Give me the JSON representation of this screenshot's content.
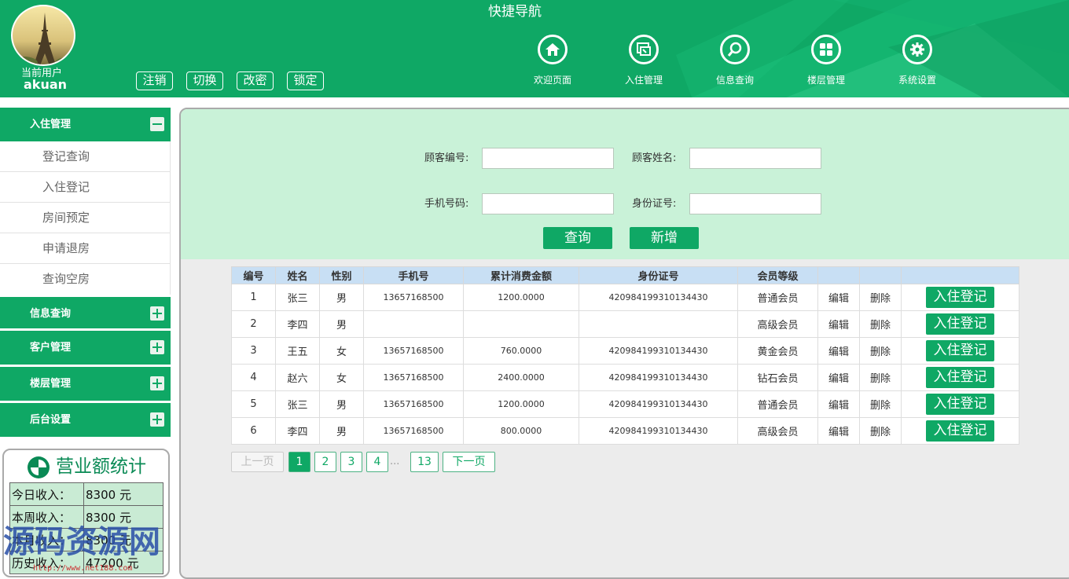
{
  "header": {
    "current_user_label": "当前用户",
    "username": "akuan",
    "buttons": [
      "注销",
      "切换",
      "改密",
      "锁定"
    ],
    "quick_nav_title": "快捷导航",
    "nav": [
      {
        "label": "欢迎页面",
        "icon": "home-icon"
      },
      {
        "label": "入住管理",
        "icon": "checkin-icon"
      },
      {
        "label": "信息查询",
        "icon": "search-icon"
      },
      {
        "label": "楼层管理",
        "icon": "grid-icon"
      },
      {
        "label": "系统设置",
        "icon": "gear-icon"
      }
    ]
  },
  "sidebar": {
    "open_group": {
      "label": "入住管理",
      "items": [
        "登记查询",
        "入住登记",
        "房间预定",
        "申请退房",
        "查询空房"
      ]
    },
    "groups": [
      "信息查询",
      "客户管理",
      "楼层管理",
      "后台设置"
    ]
  },
  "stats": {
    "title": "营业额统计",
    "rows": [
      {
        "label": "今日收入：",
        "value": "8300 元"
      },
      {
        "label": "本周收入：",
        "value": "8300 元"
      },
      {
        "label": "本月收入：",
        "value": "8300 元"
      },
      {
        "label": "历史收入：",
        "value": "47200 元"
      }
    ]
  },
  "watermark": {
    "text": "源码资源网",
    "url": "http://www.net188.com"
  },
  "search": {
    "fields": [
      {
        "label": "顾客编号:",
        "value": ""
      },
      {
        "label": "顾客姓名:",
        "value": ""
      },
      {
        "label": "手机号码:",
        "value": ""
      },
      {
        "label": "身份证号:",
        "value": ""
      }
    ],
    "query_button": "查询",
    "add_button": "新增"
  },
  "table": {
    "headers": [
      "编号",
      "姓名",
      "性别",
      "手机号",
      "累计消费金额",
      "身份证号",
      "会员等级",
      "",
      "",
      ""
    ],
    "edit_label": "编辑",
    "delete_label": "删除",
    "checkin_label": "入住登记",
    "rows": [
      {
        "id": "1",
        "name": "张三",
        "gender": "男",
        "phone": "13657168500",
        "amount": "1200.0000",
        "idcard": "420984199310134430",
        "level": "普通会员"
      },
      {
        "id": "2",
        "name": "李四",
        "gender": "男",
        "phone": "",
        "amount": "",
        "idcard": "",
        "level": "高级会员"
      },
      {
        "id": "3",
        "name": "王五",
        "gender": "女",
        "phone": "13657168500",
        "amount": "760.0000",
        "idcard": "420984199310134430",
        "level": "黄金会员"
      },
      {
        "id": "4",
        "name": "赵六",
        "gender": "女",
        "phone": "13657168500",
        "amount": "2400.0000",
        "idcard": "420984199310134430",
        "level": "钻石会员"
      },
      {
        "id": "5",
        "name": "张三",
        "gender": "男",
        "phone": "13657168500",
        "amount": "1200.0000",
        "idcard": "420984199310134430",
        "level": "普通会员"
      },
      {
        "id": "6",
        "name": "李四",
        "gender": "男",
        "phone": "13657168500",
        "amount": "800.0000",
        "idcard": "420984199310134430",
        "level": "高级会员"
      }
    ]
  },
  "pagination": {
    "prev": "上一页",
    "pages": [
      "1",
      "2",
      "3",
      "4"
    ],
    "ellipsis": "...",
    "last": "13",
    "next": "下一页",
    "current": "1"
  },
  "colors": {
    "brand": "#0fa865",
    "panel": "#c9f2d8",
    "table_header": "#c8dff4"
  }
}
